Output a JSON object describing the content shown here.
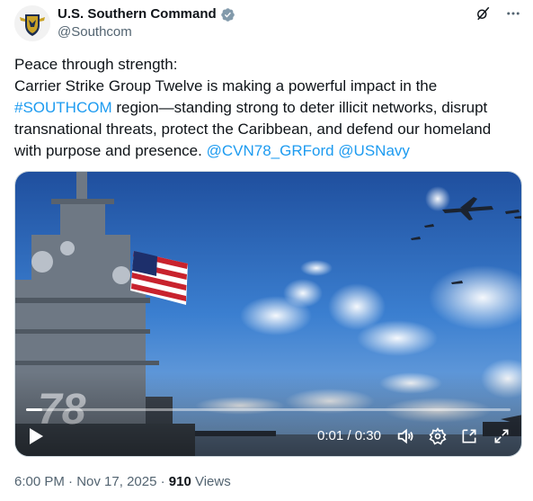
{
  "account": {
    "display_name": "U.S. Southern Command",
    "handle": "@Southcom",
    "verified_badge_color": "#829aab"
  },
  "icons": {
    "grok": "grok-icon",
    "more": "more-icon",
    "verified": "verified-badge-icon"
  },
  "tweet": {
    "line1": "Peace through strength:",
    "line2": "Carrier Strike Group Twelve is making a powerful impact in the",
    "hashtag": "#SOUTHCOM",
    "line3_rest": " region—standing strong to deter illicit networks, disrupt",
    "line4": "transnational threats, protect the Caribbean, and defend our homeland",
    "line5": "with purpose and presence. ",
    "mention1": "@CVN78_GRFord",
    "mention2": "@USNavy",
    "link_color": "#1d9bf0"
  },
  "video": {
    "hull_number": "78",
    "current_time": "0:01",
    "separator": " / ",
    "duration": "0:30",
    "progress_fraction": 0.033
  },
  "meta": {
    "time": "6:00 PM",
    "separator": " · ",
    "date": "Nov 17, 2025",
    "views_count": "910",
    "views_label": " Views"
  }
}
